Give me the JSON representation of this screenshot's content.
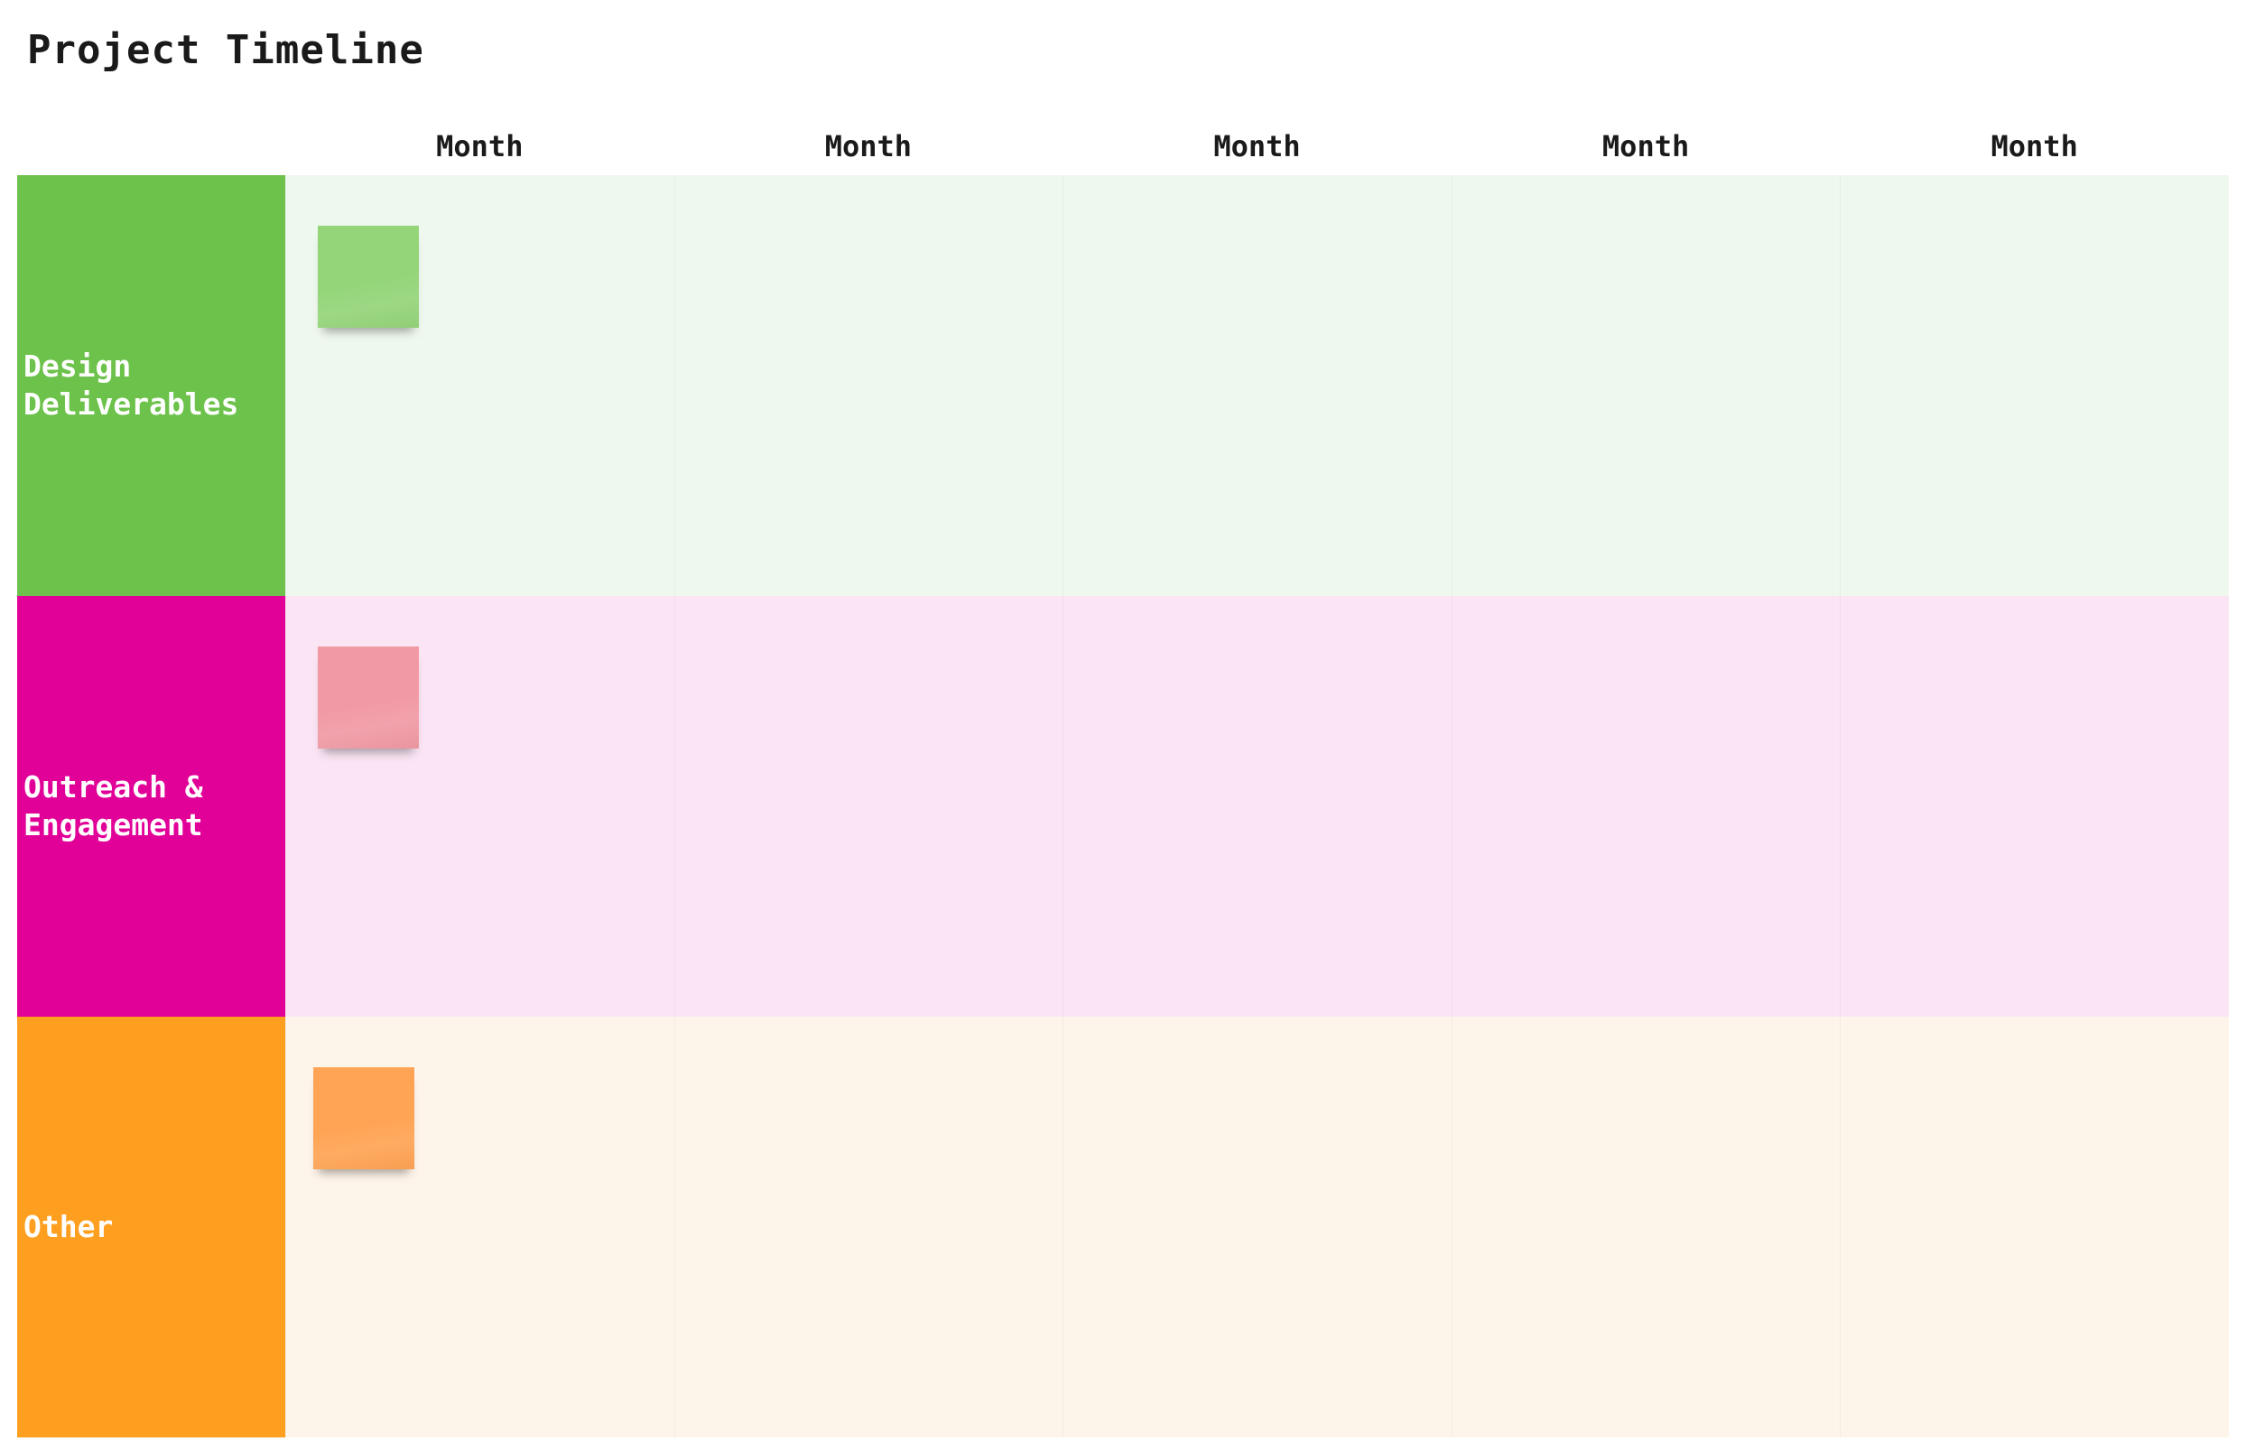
{
  "page": {
    "title": "Project Timeline"
  },
  "timeline": {
    "months": [
      "Month",
      "Month",
      "Month",
      "Month",
      "Month"
    ],
    "lanes": [
      {
        "label": "Design\nDeliverables",
        "label_color": "#6cc24a",
        "background_color": "#eff8ee",
        "sticky_color": "#95d57a"
      },
      {
        "label": "Outreach &\nEngagement",
        "label_color": "#e10098",
        "background_color": "#fbe5f5",
        "sticky_color": "#f19aa5"
      },
      {
        "label": "Other",
        "label_color": "#ff9f1f",
        "background_color": "#fef5ea",
        "sticky_color": "#ffa455"
      }
    ]
  }
}
